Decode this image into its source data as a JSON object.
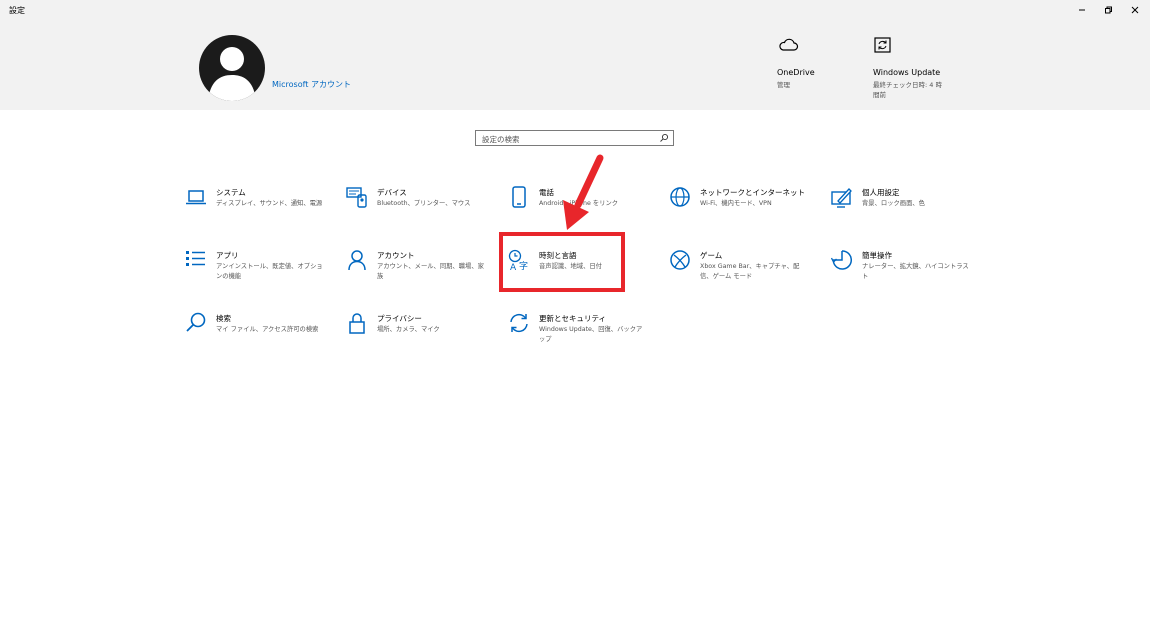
{
  "window": {
    "title": "設定",
    "controls": [
      "minimize-icon",
      "restore-icon",
      "close-icon"
    ]
  },
  "header": {
    "account_link": "Microsoft アカウント",
    "onedrive": {
      "title": "OneDrive",
      "sub": "管理"
    },
    "windows_update": {
      "title": "Windows Update",
      "sub": "最終チェック日時: 4 時間前"
    }
  },
  "search": {
    "placeholder": "設定の検索"
  },
  "tiles": [
    {
      "title": "システム",
      "sub": "ディスプレイ、サウンド、通知、電源",
      "icon": "laptop-icon"
    },
    {
      "title": "デバイス",
      "sub": "Bluetooth、プリンター、マウス",
      "icon": "devices-icon"
    },
    {
      "title": "電話",
      "sub": "Android、iPhone をリンク",
      "icon": "phone-icon"
    },
    {
      "title": "ネットワークとインターネット",
      "sub": "Wi-Fi、機内モード、VPN",
      "icon": "globe-icon"
    },
    {
      "title": "個人用設定",
      "sub": "背景、ロック画面、色",
      "icon": "personalization-icon"
    },
    {
      "title": "アプリ",
      "sub": "アンインストール、既定値、オプションの機能",
      "icon": "apps-list-icon"
    },
    {
      "title": "アカウント",
      "sub": "アカウント、メール、同期、職場、家族",
      "icon": "person-icon"
    },
    {
      "title": "時刻と言語",
      "sub": "音声認識、地域、日付",
      "icon": "time-language-icon"
    },
    {
      "title": "ゲーム",
      "sub": "Xbox Game Bar、キャプチャ、配信、ゲーム モード",
      "icon": "xbox-icon"
    },
    {
      "title": "簡単操作",
      "sub": "ナレーター、拡大鏡、ハイコントラスト",
      "icon": "ease-of-access-icon"
    },
    {
      "title": "検索",
      "sub": "マイ ファイル、アクセス許可の検索",
      "icon": "search-icon"
    },
    {
      "title": "プライバシー",
      "sub": "場所、カメラ、マイク",
      "icon": "lock-icon"
    },
    {
      "title": "更新とセキュリティ",
      "sub": "Windows Update、回復、バックアップ",
      "icon": "sync-icon"
    }
  ],
  "colors": {
    "accent": "#0067c0",
    "highlight": "#e8262b",
    "header_bg": "#f2f2f2"
  }
}
